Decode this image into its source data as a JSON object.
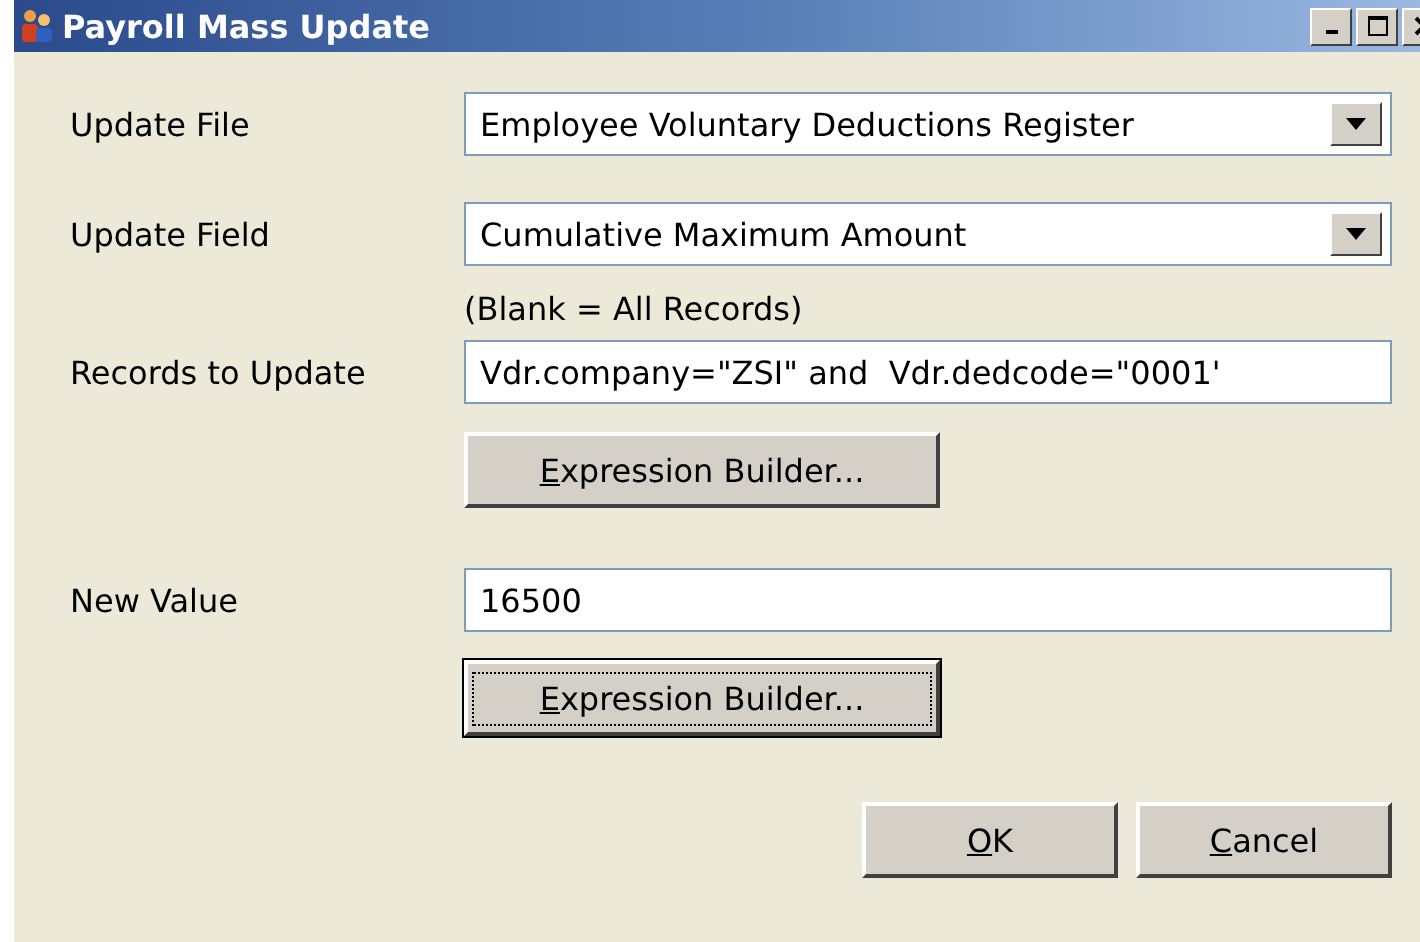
{
  "window": {
    "title": "Payroll Mass Update"
  },
  "form": [
    {
      "kind": "dropdown",
      "label": "Update File",
      "value": "Employee Voluntary Deductions Register"
    },
    {
      "kind": "dropdown",
      "label": "Update Field",
      "value": "Cumulative Maximum Amount"
    },
    {
      "kind": "note",
      "text": "(Blank = All Records)"
    },
    {
      "kind": "text",
      "label": "Records to Update",
      "value": "Vdr.company=\"ZSI\" and  Vdr.dedcode=\"0001'"
    },
    {
      "kind": "button",
      "label": "Expression Builder...",
      "focused": false
    },
    {
      "kind": "text",
      "label": "New Value",
      "value": "16500"
    },
    {
      "kind": "button",
      "label": "Expression Builder...",
      "focused": true
    }
  ],
  "buttons": [
    "OK",
    "Cancel"
  ]
}
